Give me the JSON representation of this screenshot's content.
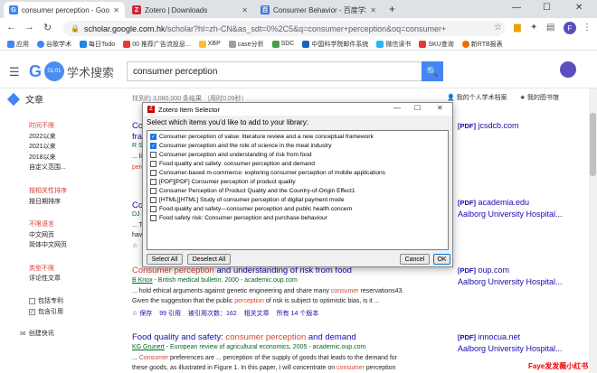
{
  "tabs": [
    {
      "title": "consumer perception - Google",
      "favicon": "G",
      "color": "#4285f4",
      "active": true
    },
    {
      "title": "Zotero | Downloads",
      "favicon": "Z",
      "color": "#cc2936",
      "active": false
    },
    {
      "title": "Consumer Behavior - 百度学术",
      "favicon": "百",
      "color": "#3f6fe0",
      "active": false
    }
  ],
  "new_tab": "+",
  "window": {
    "minimize": "—",
    "maximize": "☐",
    "close": "✕"
  },
  "address": {
    "host": "scholar.google.com.hk",
    "rest": "/scholar?hl=zh-CN&as_sdt=0%2C5&q=consumer+perception&oq=consumer+"
  },
  "profile_initial": "F",
  "bookmarks": [
    {
      "label": "应用",
      "color": "#4285f4"
    },
    {
      "label": "谷歌学术",
      "color": "#4285f4"
    },
    {
      "label": "每日Todo",
      "color": "#1e88e5"
    },
    {
      "label": "00 推荐广告流投息...",
      "color": "#e53935"
    },
    {
      "label": "XBP",
      "color": "#fbc02d"
    },
    {
      "label": "case分析",
      "color": "#9e9e9e"
    },
    {
      "label": "SDC",
      "color": "#43a047"
    },
    {
      "label": "中国科学院邮件系统",
      "color": "#1565c0"
    },
    {
      "label": "微信读书",
      "color": "#29b6f6"
    },
    {
      "label": "SKU查询",
      "color": "#e53935"
    },
    {
      "label": "新RTB报表",
      "color": "#ef6c00"
    }
  ],
  "scholar": {
    "logo_letter": "G",
    "badge": "01:01",
    "logo_cn": "学术搜索",
    "query": "consumer perception",
    "articles_label": "文章",
    "results_count": "找到约 3,080,000 条结果 （用时0.09秒）",
    "my_profile": "我的个人学术档案",
    "my_library": "我的图书馆"
  },
  "sidebar": {
    "time_header": "时间不限",
    "time_items": [
      "2022以来",
      "2021以来",
      "2018以来",
      "自定义范围..."
    ],
    "sort_header": "按相关性排序",
    "sort_date": "按日期排序",
    "lang_header": "不限语言",
    "lang_items": [
      "中文网页",
      "简体中文网页"
    ],
    "type_header": "类型不限",
    "type_review": "评论性文章",
    "include_patents": "包括专利",
    "include_citations": "包含引用",
    "create_alert": "创建快讯"
  },
  "results": [
    {
      "title_partial": "Cons",
      "line2": "fram",
      "line3": "R S",
      "line4": "... li",
      "line5": "perc"
    },
    {
      "title_partial": "Cons",
      "line2": "DJ",
      "line3": "... T",
      "line4": "have"
    },
    {
      "title_hl": "Consumer perception",
      "title_rest": " and understanding of risk from food",
      "author": "B Knox",
      "source": " - British medical bulletin, 2000 - academic.oup.com",
      "snippet1_pre": "... hold ethical arguments against genetic engineering and share many ",
      "snippet1_hl": "consumer",
      "snippet1_post": " reservations43.",
      "snippet2_pre": "Given the suggestion that the public ",
      "snippet2_hl": "perception",
      "snippet2_post": " of risk is subject to optimistic bias, is it ...",
      "actions": [
        "☆ 保存",
        "99 引用",
        "被引用次数：162",
        "相关文章",
        "所有 14 个版本"
      ]
    },
    {
      "title_pre": "Food quality and safety: ",
      "title_hl": "consumer perception",
      "title_rest": " and demand",
      "author": "KG Grunert",
      "source": " - European review of agricultural economics, 2005 - academic.oup.com",
      "snippet1_pre": "... ",
      "snippet1_hl": "Consumer",
      "snippet1_post": " preferences are ... perception of the supply of goods that leads to the demand for",
      "snippet2_pre": "these goods, as illustrated in Figure 1. In this paper, I will concentrate on ",
      "snippet2_hl": "consumer",
      "snippet2_post": " perception"
    }
  ],
  "right_links": [
    {
      "tag": "[PDF]",
      "host": "jcsdcb.com"
    },
    {
      "tag": "[PDF]",
      "host": "academia.edu",
      "sub": "Aalborg University Hospital..."
    },
    {
      "tag": "[PDF]",
      "host": "oup.com",
      "sub": "Aalborg University Hospital..."
    },
    {
      "tag": "[PDF]",
      "host": "innocua.net",
      "sub": "Aalborg University Hospital..."
    }
  ],
  "dialog": {
    "title": "Zotero Item Selector",
    "prompt": "Select which items you'd like to add to your library:",
    "items": [
      {
        "label": "Consumer perception of value: literature review and a new conceptual framework",
        "checked": true
      },
      {
        "label": "Consumer perception and the role of science in the meat industry",
        "checked": true
      },
      {
        "label": "Consumer perception and understanding of risk from food",
        "checked": false
      },
      {
        "label": "Food quality and safety: consumer perception and demand",
        "checked": false
      },
      {
        "label": "Consumer-based m-commerce: exploring consumer perception of mobile applications",
        "checked": false
      },
      {
        "label": "[PDF][PDF] Consumer perception of product quality",
        "checked": false
      },
      {
        "label": "Consumer Perception of Product Quality and the Country-of-Origin Effect1",
        "checked": false
      },
      {
        "label": "[HTML][HTML] Study of consumer perception of digital payment mode",
        "checked": false
      },
      {
        "label": "Food quality and safety—consumer perception and public health concern",
        "checked": false
      },
      {
        "label": "Food safety risk: Consumer perception and purchase behaviour",
        "checked": false
      }
    ],
    "select_all": "Select All",
    "deselect_all": "Deselect All",
    "cancel": "Cancel",
    "ok": "OK"
  },
  "watermark": "Faye发发薇小红书"
}
